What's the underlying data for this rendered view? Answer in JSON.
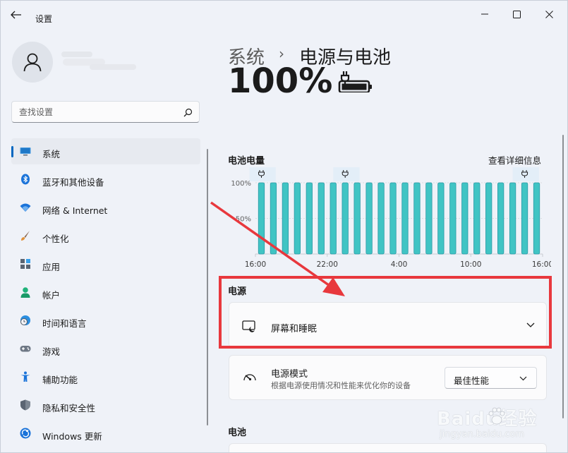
{
  "window": {
    "title": "设置",
    "controls": {
      "minimize": "minimize-icon",
      "maximize": "maximize-icon",
      "close": "close-icon"
    }
  },
  "sidebar": {
    "search_placeholder": "查找设置",
    "items": [
      {
        "label": "系统",
        "icon": "system-display-icon",
        "active": true
      },
      {
        "label": "蓝牙和其他设备",
        "icon": "bluetooth-icon"
      },
      {
        "label": "网络 & Internet",
        "icon": "wifi-icon"
      },
      {
        "label": "个性化",
        "icon": "brush-icon"
      },
      {
        "label": "应用",
        "icon": "apps-icon"
      },
      {
        "label": "帐户",
        "icon": "account-icon"
      },
      {
        "label": "时间和语言",
        "icon": "globe-clock-icon"
      },
      {
        "label": "游戏",
        "icon": "gamepad-icon"
      },
      {
        "label": "辅助功能",
        "icon": "accessibility-icon"
      },
      {
        "label": "隐私和安全性",
        "icon": "shield-icon"
      },
      {
        "label": "Windows 更新",
        "icon": "windows-update-icon"
      }
    ]
  },
  "main": {
    "breadcrumb_parent": "系统",
    "breadcrumb_separator": "›",
    "page_title": "电源与电池",
    "battery_percent": "100%",
    "battery_icon": "battery-charging-icon",
    "chart_title": "电池电量",
    "details_link": "查看详细信息",
    "power_section": "电源",
    "sleep_card": {
      "label": "屏幕和睡眠",
      "icon": "screen-sleep-icon"
    },
    "power_mode": {
      "title": "电源模式",
      "description": "根据电源使用情况和性能来优化你的设备",
      "selected": "最佳性能",
      "icon": "gauge-icon"
    },
    "battery_section": "电池"
  },
  "annotations": {
    "highlight_color": "#e8383d",
    "arrow_color": "#e8383d"
  },
  "watermark": {
    "brand": "Baidu经验",
    "site": "jingyan.baidu.com"
  },
  "chart_data": {
    "type": "bar",
    "title": "电池电量",
    "x_tick_labels": [
      "16:00",
      "22:00",
      "4:00",
      "10:00",
      "16:00"
    ],
    "y_tick_labels": [
      "100%",
      "50%"
    ],
    "ylim": [
      0,
      100
    ],
    "values": [
      100,
      100,
      100,
      100,
      100,
      100,
      100,
      100,
      100,
      100,
      100,
      100,
      100,
      100,
      100,
      100,
      100,
      100,
      100,
      100,
      100,
      100,
      100,
      100
    ],
    "charging_markers": [
      0,
      7,
      22
    ],
    "bar_color": "#40c4c4",
    "grid": true
  }
}
